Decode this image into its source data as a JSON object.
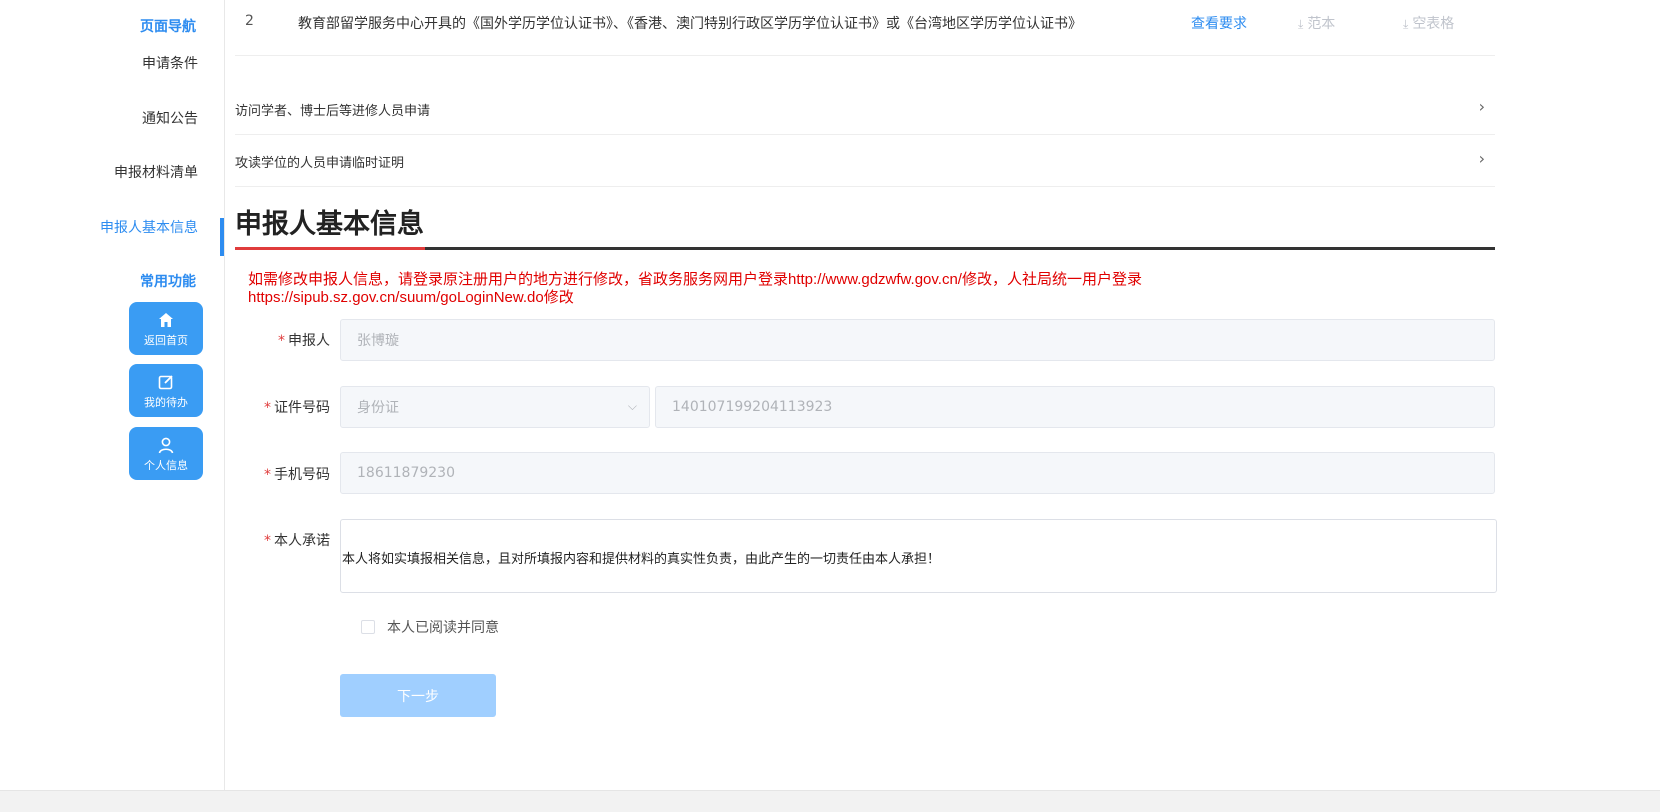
{
  "nav": {
    "section_title": "页面导航",
    "items": [
      {
        "label": "申请条件"
      },
      {
        "label": "通知公告"
      },
      {
        "label": "申报材料清单"
      },
      {
        "label": "申报人基本信息"
      }
    ],
    "common_title": "常用功能",
    "quick_actions": [
      {
        "label": "返回首页",
        "icon": "home-icon"
      },
      {
        "label": "我的待办",
        "icon": "edit-icon"
      },
      {
        "label": "个人信息",
        "icon": "user-icon"
      }
    ]
  },
  "documents": {
    "row": {
      "number": "2",
      "text": "教育部留学服务中心开具的《国外学历学位认证书》、《香港、澳门特别行政区学历学位认证书》或《台湾地区学历学位认证书》",
      "view_label": "查看要求",
      "sample_label": "范本",
      "blank_label": "空表格"
    }
  },
  "accordion": [
    {
      "label": "访问学者、博士后等进修人员申请"
    },
    {
      "label": "攻读学位的人员申请临时证明"
    }
  ],
  "section": {
    "title": "申报人基本信息"
  },
  "notice": {
    "line1": "如需修改申报人信息，请登录原注册用户的地方进行修改，省政务服务网用户登录http://www.gdzwfw.gov.cn/修改，人社局统一用户登录",
    "line2": "https://sipub.sz.gov.cn/suum/goLoginNew.do修改"
  },
  "form": {
    "applicant": {
      "label": "申报人",
      "value": "张博璇"
    },
    "id": {
      "label": "证件号码",
      "type_value": "身份证",
      "number_value": "140107199204113923"
    },
    "phone": {
      "label": "手机号码",
      "value": "18611879230"
    },
    "pledge": {
      "label": "本人承诺",
      "value": "本人将如实填报相关信息，且对所填报内容和提供材料的真实性负责，由此产生的一切责任由本人承担！"
    },
    "agree_label": "本人已阅读并同意",
    "next_label": "下一步"
  },
  "colors": {
    "accent": "#2d8cf0",
    "quick_button": "#3a9cf3",
    "notice_red": "#e00000",
    "title_red": "#e03c3c",
    "disabled_button": "#a0cfff"
  }
}
